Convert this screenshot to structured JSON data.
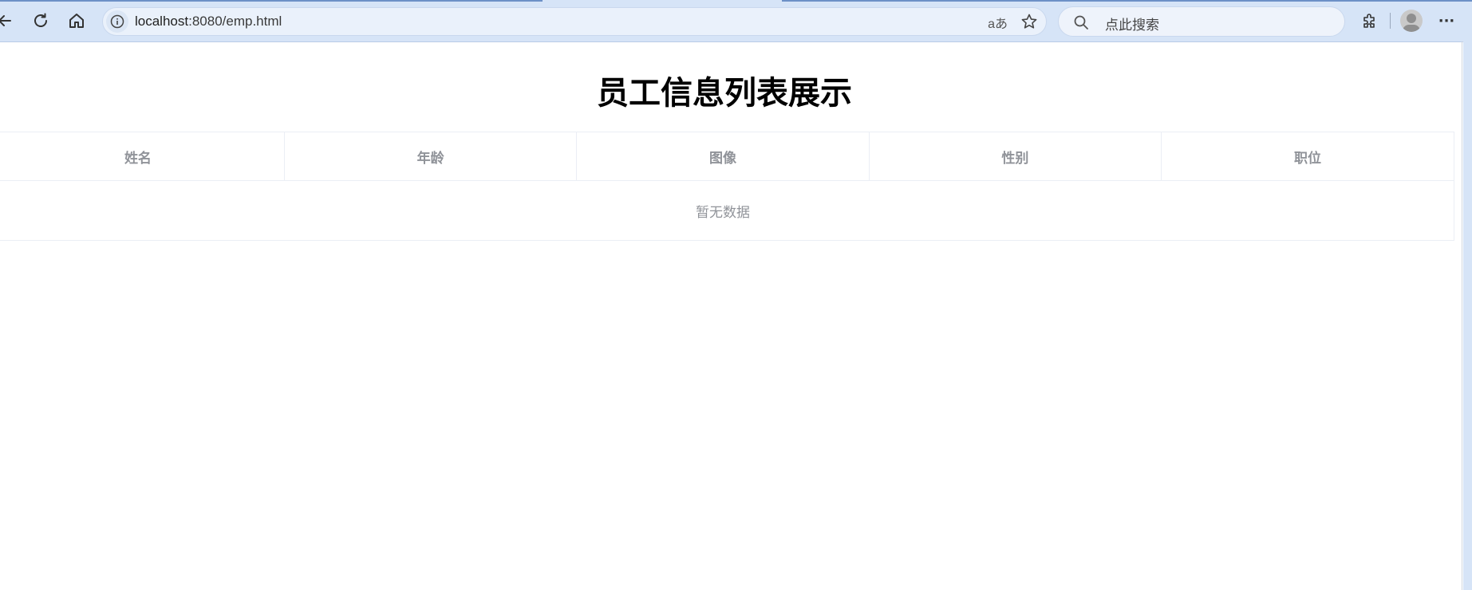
{
  "browser": {
    "url_host": "localhost",
    "url_path": ":8080/emp.html",
    "read_aloud_label": "aあ",
    "search_placeholder": "点此搜索",
    "more_label": "···"
  },
  "page": {
    "title": "员工信息列表展示"
  },
  "table": {
    "columns": [
      "姓名",
      "年龄",
      "图像",
      "性别",
      "职位"
    ],
    "empty_text": "暂无数据"
  },
  "colors": {
    "chrome_bg": "#d6e4f7",
    "header_text": "#909399",
    "border": "#ebeef5"
  }
}
